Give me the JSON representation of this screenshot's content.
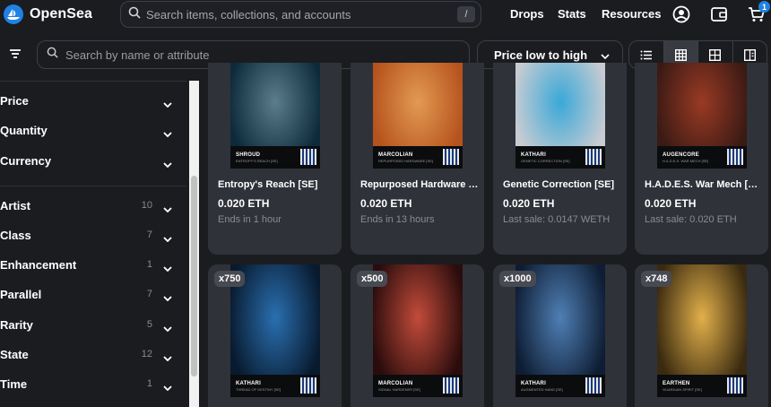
{
  "brand": {
    "name": "OpenSea",
    "color": "#2081e2"
  },
  "global_search": {
    "placeholder": "Search items, collections, and accounts",
    "shortcut": "/"
  },
  "nav": {
    "links": [
      "Drops",
      "Stats",
      "Resources"
    ],
    "cart_count": "1"
  },
  "toolbar": {
    "search_placeholder": "Search by name or attribute",
    "sort_label": "Price low to high",
    "views": [
      "list-view-icon",
      "grid-view-icon",
      "large-grid-view-icon",
      "split-view-icon"
    ],
    "active_view": "grid-view-icon"
  },
  "sidebar": {
    "primary": [
      {
        "label": "Price"
      },
      {
        "label": "Quantity"
      },
      {
        "label": "Currency"
      }
    ],
    "traits": [
      {
        "label": "Artist",
        "count": "10"
      },
      {
        "label": "Class",
        "count": "7"
      },
      {
        "label": "Enhancement",
        "count": "1"
      },
      {
        "label": "Parallel",
        "count": "7"
      },
      {
        "label": "Rarity",
        "count": "5"
      },
      {
        "label": "State",
        "count": "12"
      },
      {
        "label": "Time",
        "count": "1"
      }
    ]
  },
  "cards": [
    {
      "name": "Entropy's Reach [SE]",
      "price": "0.020 ETH",
      "meta": "Ends in 1 hour",
      "maker": "SHROUD",
      "maker_sub": "ENTROPY'S REACH [SE]",
      "colors": [
        "#0d2a3a",
        "#5b7d8c"
      ]
    },
    {
      "name": "Repurposed Hardware [S...",
      "price": "0.020 ETH",
      "meta": "Ends in 13 hours",
      "maker": "MARCOLIAN",
      "maker_sub": "REPURPOSED HARDWARE [SE]",
      "colors": [
        "#b5521d",
        "#e39a52"
      ]
    },
    {
      "name": "Genetic Correction [SE]",
      "price": "0.020 ETH",
      "meta": "Last sale: 0.0147 WETH",
      "maker": "KATHARI",
      "maker_sub": "GENETIC CORRECTION [SE]",
      "colors": [
        "#c8ccd2",
        "#3aa8d8"
      ]
    },
    {
      "name": "H.A.D.E.S. War Mech [SE]",
      "price": "0.020 ETH",
      "meta": "Last sale: 0.020 ETH",
      "maker": "AUGENCORE",
      "maker_sub": "H.A.D.E.S. WAR MECH [SE]",
      "colors": [
        "#3a1a14",
        "#9a3a24"
      ]
    },
    {
      "qty": "x750",
      "maker": "KATHARI",
      "maker_sub": "THREAD OF DESTINY [SE]",
      "colors": [
        "#081a2e",
        "#2a6fb0"
      ]
    },
    {
      "qty": "x500",
      "maker": "MARCOLIAN",
      "maker_sub": "SIGNAL HARDENER [SE]",
      "colors": [
        "#2a0c0c",
        "#c24b3a"
      ]
    },
    {
      "qty": "x1000",
      "maker": "KATHARI",
      "maker_sub": "AUGMENTED HAND [SE]",
      "colors": [
        "#0e1d33",
        "#4f7fb5"
      ]
    },
    {
      "qty": "x748",
      "maker": "EARTHEN",
      "maker_sub": "GUARDIAN SPIRIT [SE]",
      "colors": [
        "#3a2a10",
        "#e2b04a"
      ]
    }
  ]
}
